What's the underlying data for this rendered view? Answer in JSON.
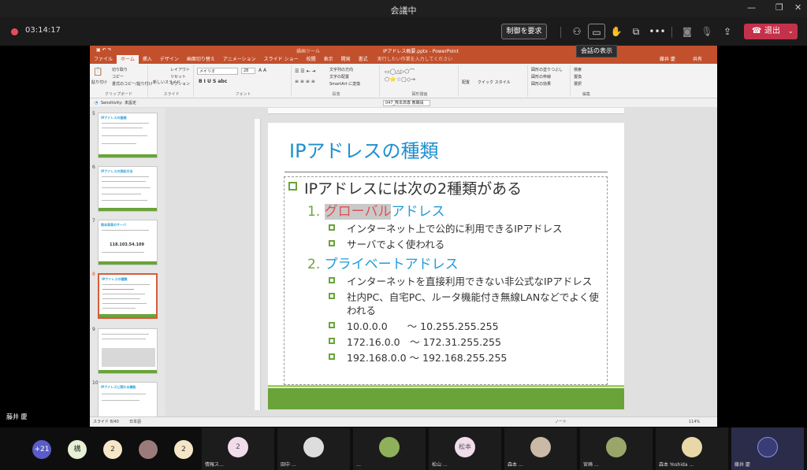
{
  "window": {
    "title": "会議中"
  },
  "meeting": {
    "timer": "03:14:17",
    "request_control": "制御を要求",
    "leave": "退出",
    "tooltip": "会話の表示",
    "self_name": "藤井 慶"
  },
  "ppt": {
    "title": "IPアドレス概要.pptx - PowerPoint",
    "tabs": [
      "ファイル",
      "ホーム",
      "挿入",
      "デザイン",
      "画面切り替え",
      "アニメーション",
      "スライド ショー",
      "校閲",
      "表示",
      "開発",
      "書式"
    ],
    "search_placeholder": "実行したい作業を入力してください",
    "user": "藤井 慶",
    "share": "共有",
    "ribbon": {
      "paste": "貼り付け",
      "clipboard": "クリップボード",
      "cut": "切り取り",
      "copy": "コピー",
      "format_painter": "書式のコピー/貼り付け",
      "new_slide": "新しいスライド",
      "layout": "レイアウト",
      "reset": "リセット",
      "section": "セクション",
      "slides": "スライド",
      "font_name": "メイリオ",
      "font_size": "28",
      "font": "フォント",
      "text_direction": "文字列の方向",
      "align_text": "文字の配置",
      "smartart": "SmartArt に変換",
      "paragraph": "段落",
      "drawing": "図形描画",
      "arrange": "配置",
      "quick_styles": "クイック スタイル",
      "fill": "図形の塗りつぶし",
      "outline": "図形の枠線",
      "effects": "図形の効果",
      "find": "検索",
      "replace": "置換",
      "select": "選択",
      "editing": "編集"
    },
    "sensitivity": "Sensitivity:",
    "sensitivity_value": "未設定",
    "file_tab": "047_熊本高専 教職員",
    "thumbs": [
      {
        "num": "5",
        "title": "IPアドレスの基礎"
      },
      {
        "num": "6",
        "title": "IPアドレスの表記方法"
      },
      {
        "num": "7",
        "title": "熊本高専のサーバ"
      },
      {
        "num": "8",
        "title": "IPアドレスの種類"
      },
      {
        "num": "9",
        "title": ""
      },
      {
        "num": "10",
        "title": "IPアドレスに関わる機能"
      }
    ],
    "thumb7_ip": "118.103.54.109",
    "status_left": "スライド 8/40",
    "status_lang": "日本語",
    "status_note": "ノート",
    "zoom": "114%"
  },
  "slide": {
    "title": "IPアドレスの種類",
    "lead": "IPアドレスには次の2種類がある",
    "items": [
      {
        "num": "1.",
        "hl": "グローバル",
        "rest": "アドレス",
        "subs": [
          "インターネット上で公的に利用できるIPアドレス",
          "サーバでよく使われる"
        ]
      },
      {
        "num": "2.",
        "hl": "",
        "rest": "プライベートアドレス",
        "subs": [
          "インターネットを直接利用できない非公式なIPアドレス",
          "社内PC、自宅PC、ルータ機能付き無線LANなどでよく使",
          "われる"
        ]
      }
    ],
    "ranges": [
      "10.0.0.0　　～ 10.255.255.255",
      "172.16.0.0　～ 172.31.255.255",
      "192.168.0.0 ～ 192.168.255.255"
    ]
  },
  "participants": {
    "count_more": "+21",
    "bubbles": [
      "構",
      "2",
      "",
      "2"
    ],
    "tiles": [
      {
        "label": "2",
        "name": "情報ス…"
      },
      {
        "label": "",
        "name": "田中 …"
      },
      {
        "label": "",
        "name": "…"
      },
      {
        "label": "松本",
        "name": "松山 …"
      },
      {
        "label": "",
        "name": "森本 …"
      },
      {
        "label": "",
        "name": "宮崎 …"
      },
      {
        "label": "",
        "name": "森本 Yoshida …"
      },
      {
        "label": "",
        "name": "藤井 慶"
      }
    ]
  },
  "colors": {
    "accent_orange": "#c2502c",
    "slide_blue": "#1e8fd0",
    "slide_green": "#6aa33a",
    "leave_red": "#c4314b",
    "record_red": "#e94b5b"
  }
}
